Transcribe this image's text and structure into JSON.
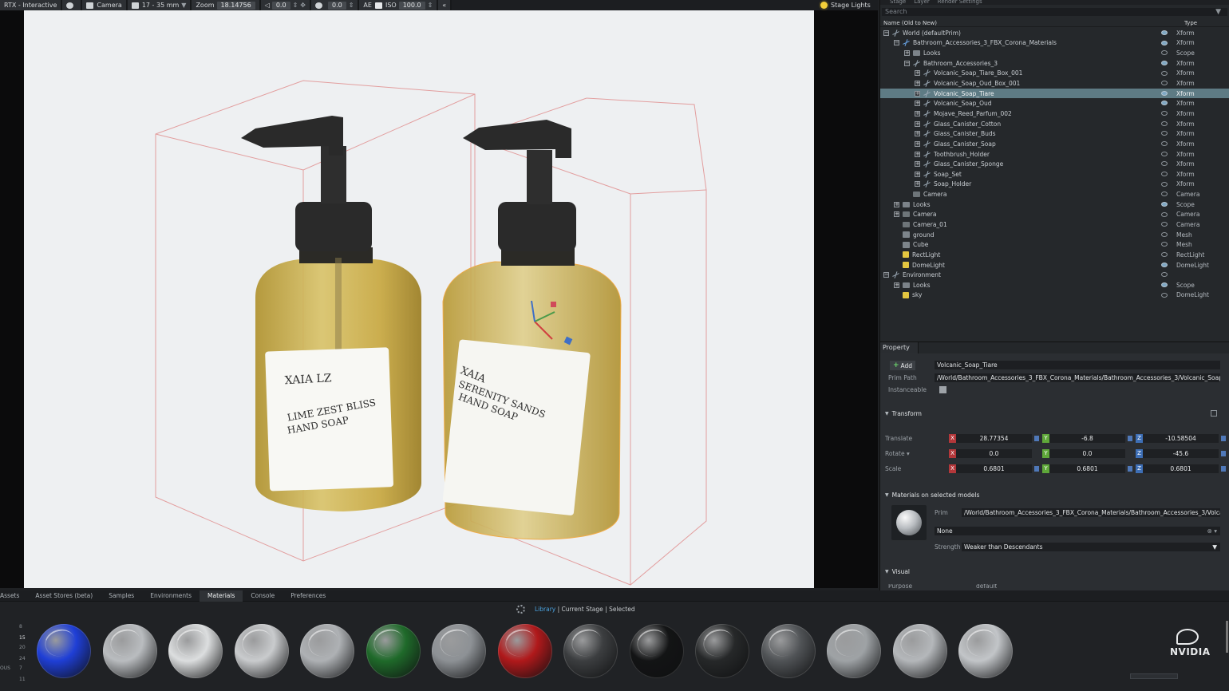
{
  "toolbar": {
    "renderer": "RTX - Interactive",
    "camera": "Camera",
    "lens": "17 - 35 mm",
    "zoom_label": "Zoom",
    "zoom_value": "18.14756",
    "angle_value": "0.0",
    "aperture_value": "0.0",
    "ae_label": "AE",
    "iso_label": "ISO",
    "iso_value": "100.0",
    "stage_lights": "Stage Lights"
  },
  "scene": {
    "bottle_left": {
      "brand": "XAIA LZ",
      "line1": "LIME ZEST BLISS",
      "line2": "HAND SOAP"
    },
    "bottle_right": {
      "brand": "XAIA",
      "line1": "SERENITY SANDS",
      "line2": "HAND SOAP"
    }
  },
  "stage": {
    "search_placeholder": "Search",
    "col_name": "Name (Old to New)",
    "col_type": "Type",
    "rows": [
      {
        "name": "World (defaultPrim)",
        "type": "Xform",
        "depth": 0,
        "toggle": "−",
        "icon": "xform",
        "eye": true,
        "selected": false
      },
      {
        "name": "Bathroom_Accessories_3_FBX_Corona_Materials",
        "type": "Xform",
        "depth": 1,
        "toggle": "−",
        "icon": "xform-blue",
        "eye": true,
        "selected": false
      },
      {
        "name": "Looks",
        "type": "Scope",
        "depth": 2,
        "toggle": "+",
        "icon": "scope",
        "eye": false,
        "selected": false
      },
      {
        "name": "Bathroom_Accessories_3",
        "type": "Xform",
        "depth": 2,
        "toggle": "−",
        "icon": "xform",
        "eye": true,
        "selected": false
      },
      {
        "name": "Volcanic_Soap_Tiare_Box_001",
        "type": "Xform",
        "depth": 3,
        "toggle": "+",
        "icon": "xform",
        "eye": false,
        "selected": false
      },
      {
        "name": "Volcanic_Soap_Oud_Box_001",
        "type": "Xform",
        "depth": 3,
        "toggle": "+",
        "icon": "xform",
        "eye": false,
        "selected": false
      },
      {
        "name": "Volcanic_Soap_Tiare",
        "type": "Xform",
        "depth": 3,
        "toggle": "+",
        "icon": "xform",
        "eye": true,
        "selected": true
      },
      {
        "name": "Volcanic_Soap_Oud",
        "type": "Xform",
        "depth": 3,
        "toggle": "+",
        "icon": "xform",
        "eye": true,
        "selected": false
      },
      {
        "name": "Mojave_Reed_Parfum_002",
        "type": "Xform",
        "depth": 3,
        "toggle": "+",
        "icon": "xform",
        "eye": false,
        "selected": false
      },
      {
        "name": "Glass_Canister_Cotton",
        "type": "Xform",
        "depth": 3,
        "toggle": "+",
        "icon": "xform",
        "eye": false,
        "selected": false
      },
      {
        "name": "Glass_Canister_Buds",
        "type": "Xform",
        "depth": 3,
        "toggle": "+",
        "icon": "xform",
        "eye": false,
        "selected": false
      },
      {
        "name": "Glass_Canister_Soap",
        "type": "Xform",
        "depth": 3,
        "toggle": "+",
        "icon": "xform",
        "eye": false,
        "selected": false
      },
      {
        "name": "Toothbrush_Holder",
        "type": "Xform",
        "depth": 3,
        "toggle": "+",
        "icon": "xform",
        "eye": false,
        "selected": false
      },
      {
        "name": "Glass_Canister_Sponge",
        "type": "Xform",
        "depth": 3,
        "toggle": "+",
        "icon": "xform",
        "eye": false,
        "selected": false
      },
      {
        "name": "Soap_Set",
        "type": "Xform",
        "depth": 3,
        "toggle": "+",
        "icon": "xform",
        "eye": false,
        "selected": false
      },
      {
        "name": "Soap_Holder",
        "type": "Xform",
        "depth": 3,
        "toggle": "+",
        "icon": "xform",
        "eye": false,
        "selected": false
      },
      {
        "name": "Camera",
        "type": "Camera",
        "depth": 2,
        "toggle": "",
        "icon": "cam",
        "eye": false,
        "selected": false
      },
      {
        "name": "Looks",
        "type": "Scope",
        "depth": 1,
        "toggle": "+",
        "icon": "scope",
        "eye": true,
        "selected": false
      },
      {
        "name": "Camera",
        "type": "Camera",
        "depth": 1,
        "toggle": "+",
        "icon": "cam",
        "eye": false,
        "selected": false
      },
      {
        "name": "Camera_01",
        "type": "Camera",
        "depth": 1,
        "toggle": "",
        "icon": "cam",
        "eye": false,
        "selected": false
      },
      {
        "name": "ground",
        "type": "Mesh",
        "depth": 1,
        "toggle": "",
        "icon": "mesh",
        "eye": false,
        "selected": false
      },
      {
        "name": "Cube",
        "type": "Mesh",
        "depth": 1,
        "toggle": "",
        "icon": "mesh",
        "eye": false,
        "selected": false
      },
      {
        "name": "RectLight",
        "type": "RectLight",
        "depth": 1,
        "toggle": "",
        "icon": "light",
        "eye": false,
        "selected": false
      },
      {
        "name": "DomeLight",
        "type": "DomeLight",
        "depth": 1,
        "toggle": "",
        "icon": "light",
        "eye": true,
        "selected": false
      },
      {
        "name": "Environment",
        "type": "",
        "depth": 0,
        "toggle": "−",
        "icon": "xform",
        "eye": false,
        "selected": false
      },
      {
        "name": "Looks",
        "type": "Scope",
        "depth": 1,
        "toggle": "+",
        "icon": "scope",
        "eye": true,
        "selected": false
      },
      {
        "name": "sky",
        "type": "DomeLight",
        "depth": 1,
        "toggle": "",
        "icon": "light",
        "eye": false,
        "selected": false
      }
    ]
  },
  "property": {
    "tab": "Property",
    "add_label": "Add",
    "prim_name": "Volcanic_Soap_Tiare",
    "prim_path_label": "Prim Path",
    "prim_path": "/World/Bathroom_Accessories_3_FBX_Corona_Materials/Bathroom_Accessories_3/Volcanic_Soap_T",
    "instanceable_label": "Instanceable",
    "transform_header": "Transform",
    "translate_label": "Translate",
    "rotate_label": "Rotate ▾",
    "scale_label": "Scale",
    "translate": [
      "28.77354",
      "-6.8",
      "-10.58504"
    ],
    "rotate": [
      "0.0",
      "0.0",
      "-45.6"
    ],
    "scale": [
      "0.6801",
      "0.6801",
      "0.6801"
    ],
    "axis_x": "X",
    "axis_y": "Y",
    "axis_z": "Z",
    "materials_header": "Materials on selected models",
    "prim_label": "Prim",
    "material_prim": "/World/Bathroom_Accessories_3_FBX_Corona_Materials/Bathroom_Accessories_3/Volcan",
    "material_value": "None",
    "strength_label": "Strength",
    "strength_value": "Weaker than Descendants",
    "visual_header": "Visual",
    "purpose_label": "Purpose",
    "purpose_value": "default"
  },
  "bottom": {
    "tabs": [
      "Assets",
      "Asset Stores (beta)",
      "Samples",
      "Environments",
      "Materials",
      "Console",
      "Preferences"
    ],
    "active_tab": "Materials",
    "filter_library": "Library",
    "filter_stage": "Current Stage",
    "filter_selected": "Selected",
    "ruler": [
      "8",
      "15",
      "20",
      "24",
      "7",
      "11"
    ],
    "ruler_left": "OUS",
    "materials": [
      {
        "color": "#1f3fd6"
      },
      {
        "color": "#b9bcbf"
      },
      {
        "color": "#dcdedf"
      },
      {
        "color": "#c9cbcd"
      },
      {
        "color": "#aeb1b4"
      },
      {
        "color": "#1f6a2a"
      },
      {
        "color": "#8d9195"
      },
      {
        "color": "#b0191b"
      },
      {
        "color": "#3c3e40"
      },
      {
        "color": "#131415"
      },
      {
        "color": "#262829"
      },
      {
        "color": "#505356"
      },
      {
        "color": "#9ea2a5"
      },
      {
        "color": "#b4b7ba"
      },
      {
        "color": "#c2c5c8"
      }
    ],
    "logo_text": "NVIDIA"
  }
}
